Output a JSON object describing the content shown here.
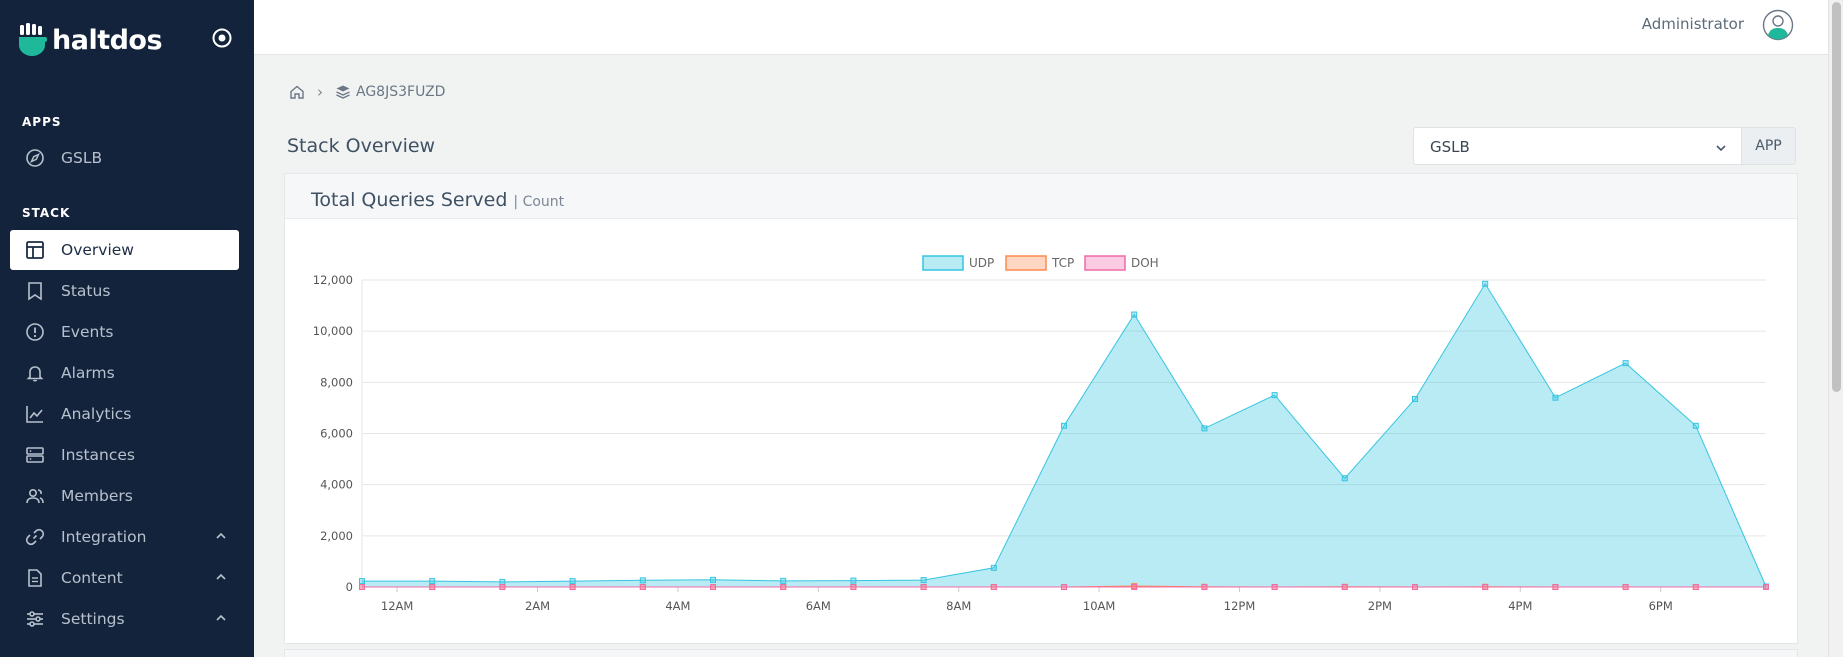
{
  "brand": {
    "name": "haltdos"
  },
  "sidebar": {
    "apps_heading": "APPS",
    "apps": [
      {
        "label": "GSLB",
        "icon": "compass-icon"
      }
    ],
    "stack_heading": "STACK",
    "items": [
      {
        "label": "Overview",
        "icon": "layout-icon",
        "active": true
      },
      {
        "label": "Status",
        "icon": "bookmark-icon"
      },
      {
        "label": "Events",
        "icon": "alert-circle-icon"
      },
      {
        "label": "Alarms",
        "icon": "bell-icon"
      },
      {
        "label": "Analytics",
        "icon": "line-chart-icon"
      },
      {
        "label": "Instances",
        "icon": "server-icon"
      },
      {
        "label": "Members",
        "icon": "users-icon"
      },
      {
        "label": "Integration",
        "icon": "link-icon",
        "expandable": true
      },
      {
        "label": "Content",
        "icon": "document-icon",
        "expandable": true
      },
      {
        "label": "Settings",
        "icon": "sliders-icon",
        "expandable": true
      }
    ]
  },
  "topbar": {
    "user_name": "Administrator"
  },
  "breadcrumb": {
    "stack_id": "AG8JS3FUZD"
  },
  "page": {
    "title": "Stack Overview"
  },
  "app_selector": {
    "selected": "GSLB",
    "button_label": "APP"
  },
  "card": {
    "title": "Total Queries Served",
    "subtitle": "| Count"
  },
  "colors": {
    "sidebar_bg": "#14233c",
    "udp": "#36c5e0",
    "tcp": "#ff8a50",
    "doh": "#f06ba8"
  },
  "chart_data": {
    "type": "area",
    "ylim": [
      0,
      12000
    ],
    "y_ticks": [
      "0",
      "2,000",
      "4,000",
      "6,000",
      "8,000",
      "10,000",
      "12,000"
    ],
    "x_ticks": [
      "12AM",
      "2AM",
      "4AM",
      "6AM",
      "8AM",
      "10AM",
      "12PM",
      "2PM",
      "4PM",
      "6PM"
    ],
    "legend": "top-center",
    "grid": true,
    "x": [
      "00:00",
      "01:00",
      "02:00",
      "03:00",
      "04:00",
      "05:00",
      "06:00",
      "07:00",
      "08:00",
      "09:00",
      "10:00",
      "11:00",
      "12:00",
      "13:00",
      "14:00",
      "15:00",
      "16:00",
      "17:00",
      "18:00",
      "19:00",
      "20:00"
    ],
    "series": [
      {
        "name": "UDP",
        "values": [
          230,
          230,
          200,
          230,
          260,
          280,
          240,
          250,
          270,
          750,
          6300,
          10650,
          6200,
          7500,
          4250,
          7350,
          11850,
          7400,
          8750,
          6300,
          20
        ]
      },
      {
        "name": "TCP",
        "values": [
          0,
          0,
          0,
          0,
          0,
          0,
          0,
          0,
          0,
          0,
          0,
          40,
          10,
          0,
          10,
          0,
          10,
          0,
          0,
          0,
          0
        ]
      },
      {
        "name": "DOH",
        "values": [
          0,
          0,
          0,
          0,
          0,
          0,
          0,
          0,
          0,
          0,
          0,
          0,
          0,
          0,
          0,
          0,
          0,
          0,
          0,
          0,
          0
        ]
      }
    ]
  }
}
